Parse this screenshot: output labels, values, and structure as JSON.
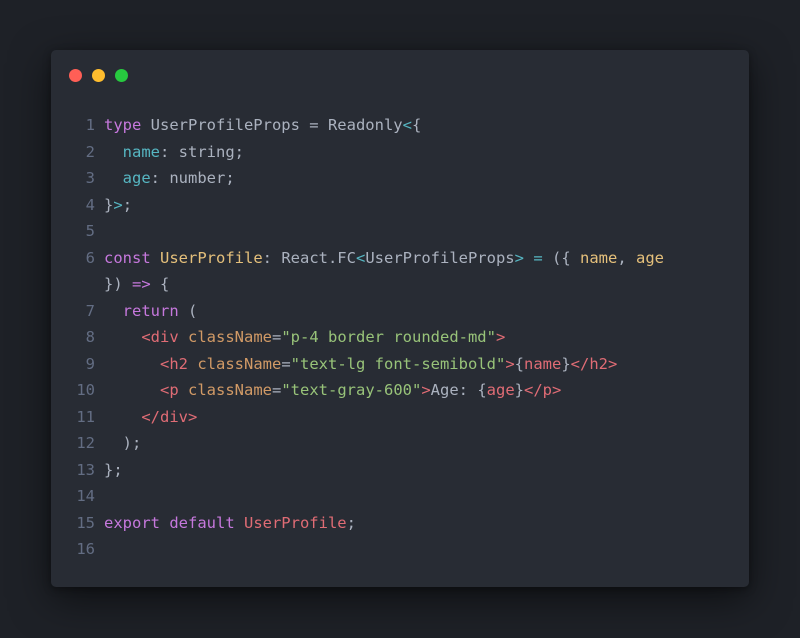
{
  "window": {
    "controls": [
      {
        "name": "close",
        "color": "#ff5f56"
      },
      {
        "name": "minimize",
        "color": "#ffbd2e"
      },
      {
        "name": "maximize",
        "color": "#27c93f"
      }
    ]
  },
  "code": {
    "lines": [
      {
        "n": "1",
        "tokens": [
          {
            "t": "type",
            "c": "kw"
          },
          {
            "t": " UserProfileProps = Readonly",
            "c": ""
          },
          {
            "t": "<",
            "c": "prop"
          },
          {
            "t": "{",
            "c": ""
          }
        ]
      },
      {
        "n": "2",
        "tokens": [
          {
            "t": "  ",
            "c": ""
          },
          {
            "t": "name",
            "c": "prop"
          },
          {
            "t": ": string;",
            "c": ""
          }
        ]
      },
      {
        "n": "3",
        "tokens": [
          {
            "t": "  ",
            "c": ""
          },
          {
            "t": "age",
            "c": "prop"
          },
          {
            "t": ": number;",
            "c": ""
          }
        ]
      },
      {
        "n": "4",
        "tokens": [
          {
            "t": "}",
            "c": ""
          },
          {
            "t": ">",
            "c": "prop"
          },
          {
            "t": ";",
            "c": ""
          }
        ]
      },
      {
        "n": "5",
        "tokens": []
      },
      {
        "n": "6",
        "tokens": [
          {
            "t": "const ",
            "c": "kw"
          },
          {
            "t": "UserProfile",
            "c": "fn"
          },
          {
            "t": ": React.FC",
            "c": ""
          },
          {
            "t": "<",
            "c": "prop"
          },
          {
            "t": "UserProfileProps",
            "c": ""
          },
          {
            "t": ">",
            "c": "prop"
          },
          {
            "t": " ",
            "c": ""
          },
          {
            "t": "=",
            "c": "prop"
          },
          {
            "t": " ({ ",
            "c": ""
          },
          {
            "t": "name",
            "c": "param"
          },
          {
            "t": ", ",
            "c": ""
          },
          {
            "t": "age",
            "c": "param"
          }
        ]
      },
      {
        "n": "",
        "tokens": [
          {
            "t": "}) ",
            "c": ""
          },
          {
            "t": "=>",
            "c": "kw"
          },
          {
            "t": " {",
            "c": ""
          }
        ]
      },
      {
        "n": "7",
        "tokens": [
          {
            "t": "  ",
            "c": ""
          },
          {
            "t": "return",
            "c": "kw"
          },
          {
            "t": " (",
            "c": ""
          }
        ]
      },
      {
        "n": "8",
        "tokens": [
          {
            "t": "    ",
            "c": ""
          },
          {
            "t": "<div ",
            "c": "tag"
          },
          {
            "t": "className",
            "c": "attr"
          },
          {
            "t": "=",
            "c": ""
          },
          {
            "t": "\"p-4 border rounded-md\"",
            "c": "str"
          },
          {
            "t": ">",
            "c": "tag"
          }
        ]
      },
      {
        "n": "9",
        "tokens": [
          {
            "t": "      ",
            "c": ""
          },
          {
            "t": "<h2 ",
            "c": "tag"
          },
          {
            "t": "className",
            "c": "attr"
          },
          {
            "t": "=",
            "c": ""
          },
          {
            "t": "\"text-lg font-semibold\"",
            "c": "str"
          },
          {
            "t": ">",
            "c": "tag"
          },
          {
            "t": "{",
            "c": ""
          },
          {
            "t": "name",
            "c": "tag"
          },
          {
            "t": "}",
            "c": ""
          },
          {
            "t": "</h2>",
            "c": "tag"
          }
        ]
      },
      {
        "n": "10",
        "tokens": [
          {
            "t": "      ",
            "c": ""
          },
          {
            "t": "<p ",
            "c": "tag"
          },
          {
            "t": "className",
            "c": "attr"
          },
          {
            "t": "=",
            "c": ""
          },
          {
            "t": "\"text-gray-600\"",
            "c": "str"
          },
          {
            "t": ">",
            "c": "tag"
          },
          {
            "t": "Age: {",
            "c": ""
          },
          {
            "t": "age",
            "c": "tag"
          },
          {
            "t": "}",
            "c": ""
          },
          {
            "t": "</p>",
            "c": "tag"
          }
        ]
      },
      {
        "n": "11",
        "tokens": [
          {
            "t": "    ",
            "c": ""
          },
          {
            "t": "</div>",
            "c": "tag"
          }
        ]
      },
      {
        "n": "12",
        "tokens": [
          {
            "t": "  );",
            "c": ""
          }
        ]
      },
      {
        "n": "13",
        "tokens": [
          {
            "t": "};",
            "c": ""
          }
        ]
      },
      {
        "n": "14",
        "tokens": []
      },
      {
        "n": "15",
        "tokens": [
          {
            "t": "export ",
            "c": "kw"
          },
          {
            "t": "default ",
            "c": "kw"
          },
          {
            "t": "UserProfile",
            "c": "tag"
          },
          {
            "t": ";",
            "c": ""
          }
        ]
      },
      {
        "n": "16",
        "tokens": []
      }
    ]
  }
}
